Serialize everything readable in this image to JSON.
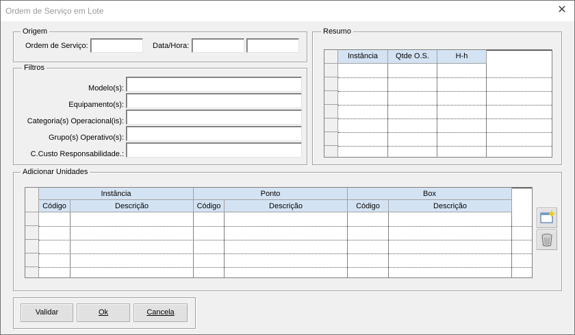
{
  "window": {
    "title": "Ordem de Serviço em Lote"
  },
  "origem": {
    "legend": "Origem",
    "ordem_label": "Ordem de Serviço:",
    "ordem_value": "",
    "datahora_label": "Data/Hora:",
    "data_value": "",
    "hora_value": ""
  },
  "filtros": {
    "legend": "Filtros",
    "fields": [
      {
        "label": "Modelo(s):",
        "value": ""
      },
      {
        "label": "Equipamento(s):",
        "value": ""
      },
      {
        "label": "Categoria(s) Operacional(is):",
        "value": ""
      },
      {
        "label": "Grupo(s) Operativo(s):",
        "value": ""
      },
      {
        "label": "C.Custo Responsabilidade.:",
        "value": ""
      }
    ]
  },
  "resumo": {
    "legend": "Resumo",
    "columns": [
      "Instância",
      "Qtde O.S.",
      "H-h"
    ]
  },
  "unidades": {
    "legend": "Adicionar Unidades",
    "groups": [
      "Instância",
      "Ponto",
      "Box"
    ],
    "sub_codigo": "Código",
    "sub_descricao": "Descrição"
  },
  "buttons": {
    "validar": "Validar",
    "ok": "Ok",
    "cancela": "Cancela"
  },
  "icons": {
    "add": "new-row-icon",
    "delete": "trash-icon"
  }
}
